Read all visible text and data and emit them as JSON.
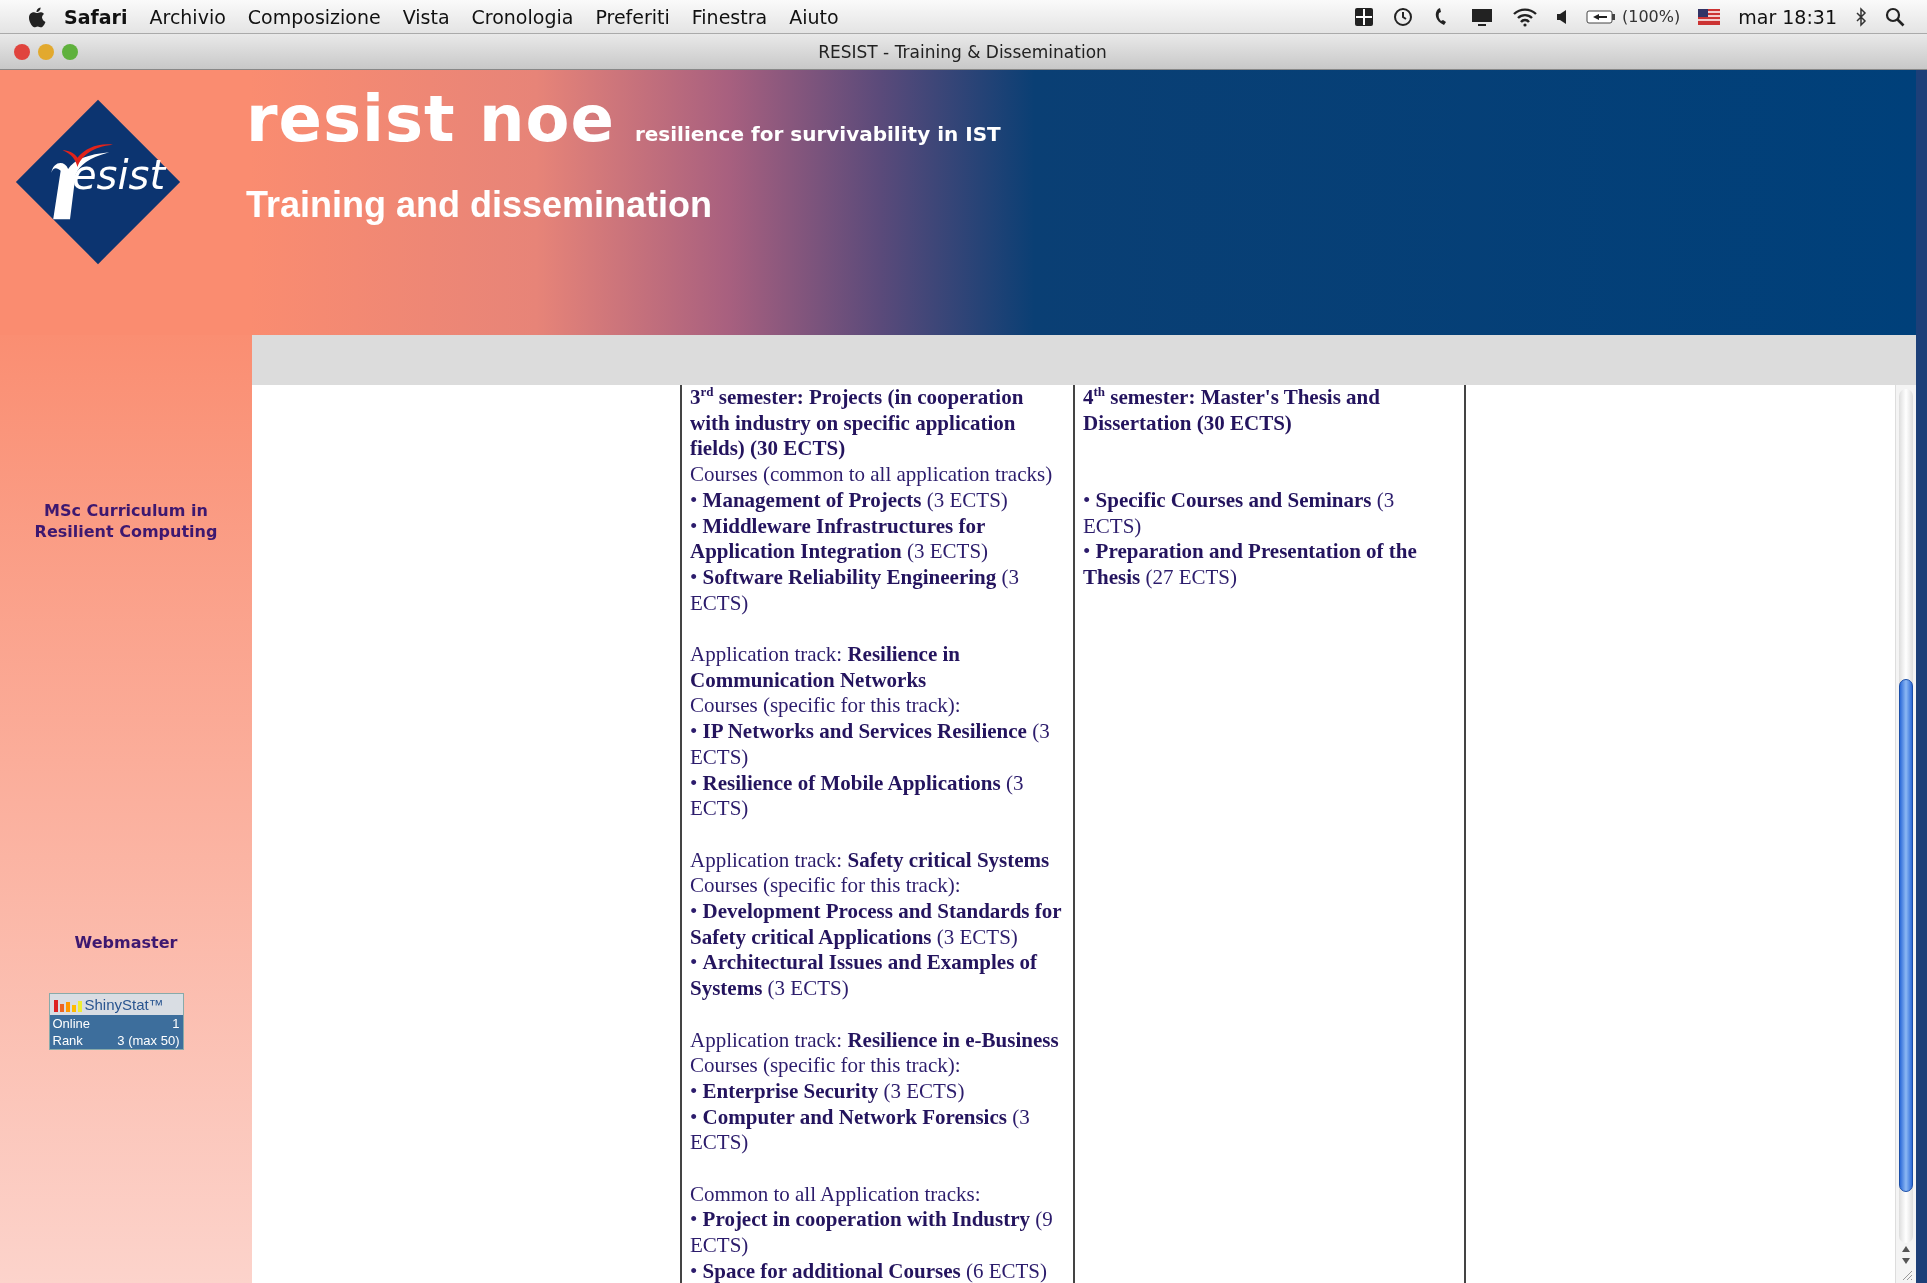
{
  "menu_bar": {
    "app": "Safari",
    "items": [
      "Archivio",
      "Composizione",
      "Vista",
      "Cronologia",
      "Preferiti",
      "Finestra",
      "Aiuto"
    ],
    "battery": "(100%)",
    "clock": "mar 18:31"
  },
  "window": {
    "title": "RESIST - Training & Dissemination"
  },
  "header": {
    "logo_text": "esist",
    "title": "resist noe",
    "tagline": "resilience for survivability in IST",
    "subtitle": "Training and dissemination"
  },
  "sidebar": {
    "links": [
      "MSc Curriculum in Resilient Computing",
      "Webmaster"
    ],
    "counter": {
      "brand": "ShinyStat™",
      "rows": [
        {
          "label": "Online",
          "value": "1"
        },
        {
          "label": "Rank",
          "value": "3 (max 50)"
        }
      ]
    }
  },
  "columns": [
    {
      "blocks": [
        {
          "lines": [
            {
              "kind": "heading",
              "text": "3$^{rd}$ semester: Projects (in cooperation with industry on specific application fields) (30 ECTS)"
            },
            {
              "kind": "text",
              "text": "Courses (common to all application tracks)"
            },
            {
              "kind": "text",
              "text": "• **Management of Projects** (3 ECTS)"
            },
            {
              "kind": "text",
              "text": "• **Middleware Infrastructures for Application Integration** (3 ECTS)"
            },
            {
              "kind": "text",
              "text": "• **Software Reliability Engineering** (3 ECTS)"
            }
          ]
        },
        {
          "lines": [
            {
              "kind": "text",
              "text": "Application track: **Resilience in Communication Networks**"
            },
            {
              "kind": "text",
              "text": "Courses (specific for this track):"
            },
            {
              "kind": "text",
              "text": "• **IP Networks and Services Resilience** (3 ECTS)"
            },
            {
              "kind": "text",
              "text": "• **Resilience of Mobile Applications** (3 ECTS)"
            }
          ]
        },
        {
          "lines": [
            {
              "kind": "text",
              "text": "Application track: **Safety critical Systems**"
            },
            {
              "kind": "text",
              "text": "Courses (specific for this track):"
            },
            {
              "kind": "text",
              "text": "• **Development Process and Standards for Safety critical Applications** (3 ECTS)"
            },
            {
              "kind": "text",
              "text": "• **Architectural Issues and Examples of Systems** (3 ECTS)"
            }
          ]
        },
        {
          "lines": [
            {
              "kind": "text",
              "text": "Application track: **Resilience in e-Business**"
            },
            {
              "kind": "text",
              "text": "Courses (specific for this track):"
            },
            {
              "kind": "text",
              "text": "• **Enterprise Security** (3 ECTS)"
            },
            {
              "kind": "text",
              "text": "• **Computer and Network Forensics** (3 ECTS)"
            }
          ]
        },
        {
          "lines": [
            {
              "kind": "text",
              "text": "Common to all Application tracks:"
            },
            {
              "kind": "text",
              "text": "• **Project in cooperation with Industry** (9 ECTS)"
            },
            {
              "kind": "text",
              "text": "• **Space for additional Courses** (6 ECTS)"
            }
          ]
        }
      ]
    },
    {
      "blocks": [
        {
          "lines": [
            {
              "kind": "heading",
              "text": "4$^{th}$ semester: Master's Thesis and Dissertation (30 ECTS)"
            }
          ]
        },
        {
          "lines": [
            {
              "kind": "text",
              "text": "• **Specific Courses and Seminars** (3 ECTS)"
            },
            {
              "kind": "text",
              "text": "• **Preparation and Presentation of the Thesis** (27 ECTS)"
            }
          ]
        }
      ]
    }
  ]
}
